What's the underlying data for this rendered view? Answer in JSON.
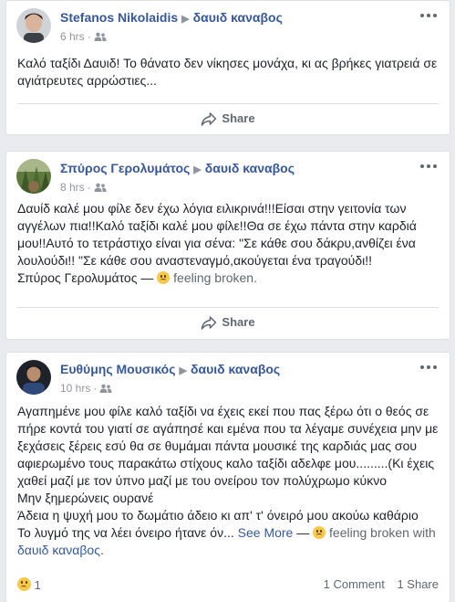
{
  "posts": [
    {
      "author": "Stefanos Nikolaidis",
      "target": "δαυιδ καναβος",
      "time": "6 hrs",
      "text": "Καλό ταξίδι Δαυιδ! Το θάνατο δεν νίκησες μονάχα, κι ας βρήκες γιατρειά σε αγιάτρευτες αρρώστιες...",
      "share_label": "Share",
      "avatar_icon": "profile-photo"
    },
    {
      "author": "Σπύρος Γερολυμάτος",
      "target": "δαυιδ καναβος",
      "time": "8 hrs",
      "text": "Δαυίδ καλέ μου φίλε δεν έχω λόγια ειλικρινά!!!Είσαι στην γειτονία των αγγέλων πια!!Καλό ταξίδι καλέ μου φίλε!!Θα σε έχω πάντα στην καρδιά μου!!Αυτό το τετράστιχο είναι για σένα: \"Σε κάθε σου δάκρυ,ανθίζει ένα λουλούδι!! \"Σε κάθε σου αναστεναγμό,ακούγεται ένα τραγούδι!!",
      "signature": "Σπύρος Γερολυμάτος —",
      "feeling": "feeling broken.",
      "share_label": "Share",
      "avatar_icon": "profile-photo"
    },
    {
      "author": "Ευθύμης Μουσικός",
      "target": "δαυιδ καναβος",
      "time": "10 hrs",
      "text_line1": "Αγαπημένε μου φίλε καλό ταξίδι να έχεις εκεί που πας ξέρω ότι ο θεός σε πήρε κοντά του γιατί σε αγάπησέ και εμένα που τα λέγαμε συνέχεια μην με ξεχάσεις ξέρεις εσύ θα σε θυμάμαι πάντα μουσικέ της καρδιάς μας σου αφιερωμένο τους παρακάτω στίχους καλο ταξίδι αδελφε μου.........(Κι έχεις χαθεί μαζί με τον ύπνο μαζί με του ονείρου τον πολύχρωμο κύκνο",
      "text_line2": "Μην ξημερώνεις ουρανέ",
      "text_line3": "Άδεια η ψυχή μου το δωμάτιο άδειο κι απ' τ' όνειρό μου ακούω καθάριο",
      "text_line4": "Το λυγμό της να λέει όνειρο ήτανε όν...",
      "see_more": "See More",
      "feeling_prefix": "—",
      "feeling": "feeling broken with",
      "feeling_with": "δαυιδ καναβος.",
      "reaction_count": "1",
      "comments": "1 Comment",
      "shares": "1 Share",
      "avatar_icon": "profile-photo"
    }
  ],
  "colors": {
    "link": "#365899",
    "meta": "#90949c",
    "background": "#e9ebee"
  }
}
